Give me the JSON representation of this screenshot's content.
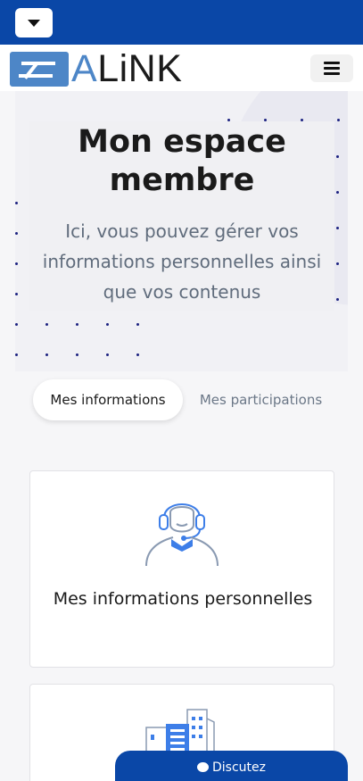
{
  "topbar": {
    "dropdown_icon": "caret-down-icon",
    "color": "#0a47a7"
  },
  "header": {
    "logo_text_blue": "A",
    "logo_text_dark": "LiNK",
    "menu_icon": "hamburger-icon"
  },
  "hero": {
    "title": "Mon espace membre",
    "subtitle": "Ici, vous pouvez gérer vos informations personnelles ainsi que vos contenus"
  },
  "tabs": [
    {
      "label": "Mes informations",
      "active": true
    },
    {
      "label": "Mes participations",
      "active": false
    }
  ],
  "cards": [
    {
      "title": "Mes informations personnelles",
      "icon": "support-agent-icon"
    },
    {
      "title": "",
      "icon": "buildings-icon"
    }
  ],
  "chat": {
    "label": "Discutez",
    "icon": "chat-bubble-icon"
  },
  "colors": {
    "brand": "#0a47a7",
    "logo_blue": "#4d86c7",
    "icon_blue": "#3d7ee8"
  }
}
